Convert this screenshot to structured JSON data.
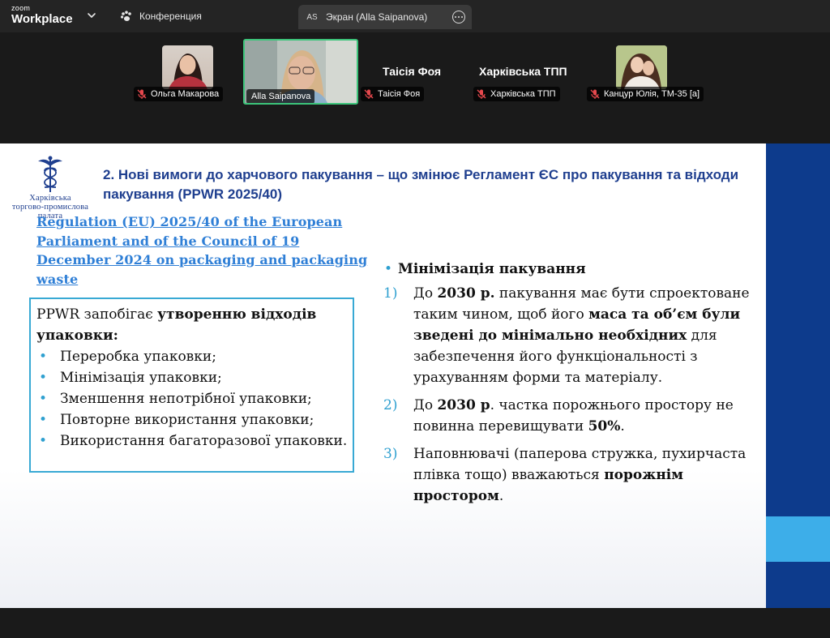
{
  "topbar": {
    "brand_small": "zoom",
    "brand_big": "Workplace",
    "conference_label": "Конференция",
    "screen_badge": "AS",
    "screen_label": "Экран (Alla Saipanova)"
  },
  "participants": [
    {
      "name": "Ольга Макарова",
      "muted": true
    },
    {
      "name": "Alla Saipanova",
      "muted": false,
      "active_speaker": true
    },
    {
      "name": "Таісія Фоя",
      "muted": true
    },
    {
      "name": "Харківська ТПП",
      "muted": true
    },
    {
      "name": "Канцур Юлія, ТМ-35 [а]",
      "muted": true
    }
  ],
  "slide": {
    "logo_lines": [
      "Харківська",
      "торгово-промислова",
      "палата"
    ],
    "title": "2. Нові вимоги до харчового пакування – що змінює Регламент ЄС про пакування та відходи пакування  (PPWR 2025/40)",
    "regulation_link": "Regulation (EU) 2025/40 of the European Parliament and of the Council of 19 December 2024 on packaging and packaging waste",
    "box": {
      "intro_plain": "PPWR запобігає ",
      "intro_bold": "утворенню відходів упаковки:",
      "items": [
        "Переробка упаковки;",
        "Мінімізація упаковки;",
        "Зменшення непотрібної упаковки;",
        "Повторне використання упаковки;",
        "Використання багаторазової упаковки."
      ]
    },
    "right": {
      "heading": "Мінімізація пакування",
      "items": [
        {
          "num": "1)",
          "parts": [
            {
              "t": "До ",
              "b": false
            },
            {
              "t": "2030 р.",
              "b": true
            },
            {
              "t": " пакування має бути спроектоване таким чином, щоб його ",
              "b": false
            },
            {
              "t": "маса та об’єм були зведені до мінімально необхідних",
              "b": true
            },
            {
              "t": " для забезпечення його функціональності з урахуванням форми та матеріалу.",
              "b": false
            }
          ]
        },
        {
          "num": "2)",
          "parts": [
            {
              "t": "До ",
              "b": false
            },
            {
              "t": "2030 р",
              "b": true
            },
            {
              "t": ". частка порожнього простору не повинна перевищувати ",
              "b": false
            },
            {
              "t": "50%",
              "b": true
            },
            {
              "t": ".",
              "b": false
            }
          ]
        },
        {
          "num": "3)",
          "parts": [
            {
              "t": "Наповнювачі (паперова стружка, пухирчаста плівка тощо) вважаються ",
              "b": false
            },
            {
              "t": "порожнім простором",
              "b": true
            },
            {
              "t": ".",
              "b": false
            }
          ]
        }
      ]
    }
  },
  "colors": {
    "active_speaker_border": "#3cc47a",
    "mic_off": "#e5484d",
    "title": "#1f3f8f",
    "link": "#2f7fd6",
    "accent": "#2fa0d0",
    "right_bar": "#0d3b8c",
    "right_bar_light": "#3daee9"
  }
}
